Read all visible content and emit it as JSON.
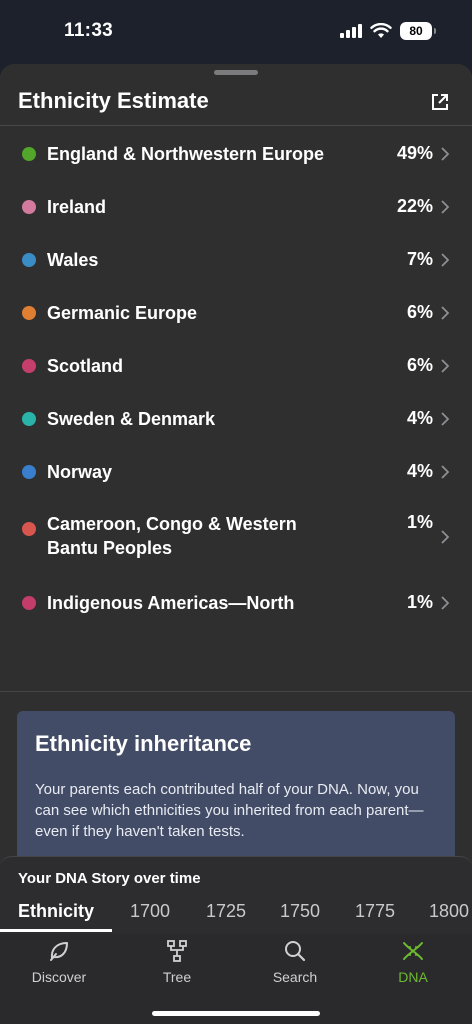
{
  "status": {
    "time": "11:33",
    "battery": "80"
  },
  "sheet": {
    "title": "Ethnicity Estimate"
  },
  "regions": [
    {
      "name": "England & Northwestern Europe",
      "percent": "49%",
      "color": "#52a62b"
    },
    {
      "name": "Ireland",
      "percent": "22%",
      "color": "#d27b9e"
    },
    {
      "name": "Wales",
      "percent": "7%",
      "color": "#3a8cc4"
    },
    {
      "name": "Germanic Europe",
      "percent": "6%",
      "color": "#e07e32"
    },
    {
      "name": "Scotland",
      "percent": "6%",
      "color": "#c63f6c"
    },
    {
      "name": "Sweden & Denmark",
      "percent": "4%",
      "color": "#2ab3a8"
    },
    {
      "name": "Norway",
      "percent": "4%",
      "color": "#3a7fcd"
    },
    {
      "name": "Cameroon, Congo & Western Bantu Peoples",
      "percent": "1%",
      "color": "#d9564f"
    },
    {
      "name": "Indigenous Americas—North",
      "percent": "1%",
      "color": "#c43c6a"
    }
  ],
  "inheritance": {
    "title": "Ethnicity inheritance",
    "body": "Your parents each contributed half of your DNA. Now, you can see which ethnicities you inherited from each parent—even if they haven't taken tests."
  },
  "story": {
    "label": "Your DNA Story over time",
    "tabs": [
      "Ethnicity",
      "1700",
      "1725",
      "1750",
      "1775",
      "1800"
    ],
    "active_tab": "Ethnicity"
  },
  "nav": [
    {
      "label": "Discover",
      "icon": "leaf-icon"
    },
    {
      "label": "Tree",
      "icon": "tree-icon"
    },
    {
      "label": "Search",
      "icon": "search-icon"
    },
    {
      "label": "DNA",
      "icon": "dna-icon",
      "active": true
    }
  ],
  "colors": {
    "accent": "#6dbb2f",
    "card": "#424c66",
    "sheet": "#2f2f30"
  }
}
